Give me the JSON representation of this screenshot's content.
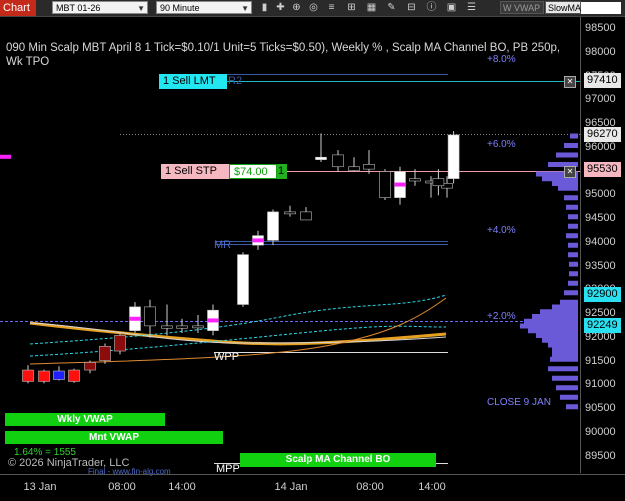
{
  "toolbar": {
    "chart_label": "Chart",
    "instrument": "MBT 01-26",
    "interval": "90 Minute",
    "buttons": {
      "vwap": "W VWAP",
      "slowma": "SlowMA"
    },
    "price_box": "",
    "icons": [
      "bars-icon",
      "crosshair-icon",
      "zoom-icon",
      "pan-icon",
      "properties-icon",
      "indicators-icon",
      "strategies-icon",
      "drawing-icon",
      "grid-icon",
      "info-icon",
      "save-icon",
      "menu-icon"
    ]
  },
  "title": "090 Min Scalp MBT April 8 1 Tick=$0.10/1 Unit=5 Ticks=$0.50), Weekly % , Scalp MA Channel BO, PB 250p, Wk TPO",
  "price_axis": {
    "ticks": [
      "98500",
      "98000",
      "97500",
      "97000",
      "96500",
      "96000",
      "95500",
      "95000",
      "94500",
      "94000",
      "93500",
      "93000",
      "92500",
      "92000",
      "91500",
      "91000",
      "90500",
      "90000",
      "89500"
    ],
    "badges": [
      {
        "value": "97410",
        "bg": "#e8e8e8"
      },
      {
        "value": "96270",
        "bg": "#e8e8e8"
      },
      {
        "value": "95530",
        "bg": "#f6b8c0"
      },
      {
        "value": "92900",
        "bg": "#28e0f0"
      },
      {
        "value": "92249",
        "bg": "#28e0f0"
      }
    ]
  },
  "time_axis": {
    "ticks": [
      "13 Jan",
      "08:00",
      "14:00",
      "14 Jan",
      "08:00",
      "14:00"
    ]
  },
  "orders": {
    "limit": {
      "label": "1 Sell LMT",
      "tag": "R2",
      "color": "#22e6f0"
    },
    "stop": {
      "label": "1 Sell STP",
      "pnl": "$74.00",
      "qty": "1",
      "color": "#f6b8c0"
    }
  },
  "labels": {
    "pct_8": "+8.0%",
    "pct_6": "+6.0%",
    "pct_4": "+4.0%",
    "pct_2": "+2.0%",
    "wpp": "WPP",
    "mr": "MR",
    "mpp": "MPP",
    "close": "CLOSE 9 JAN",
    "wkly_vwap": "Wkly VWAP",
    "mnt_vwap": "Mnt VWAP",
    "pct_note": "1.64% = 1555",
    "copyright": "© 2026 NinjaTrader, LLC",
    "website": "Final - www.fin-alg.com",
    "scalp_box": "Scalp MA Channel BO"
  },
  "chart_data": {
    "type": "candlestick",
    "title": "090 Min Scalp MBT April 8 1 Tick=$0.10/1 Unit=5 Ticks=$0.50), Weekly % , Scalp MA Channel BO, PB 250p, Wk TPO",
    "ylim": [
      89500,
      98500
    ],
    "candles": [
      {
        "t": "13 Jan",
        "o": 91320,
        "h": 91420,
        "l": 91040,
        "c": 91080,
        "color": "red"
      },
      {
        "t": "13 Jan",
        "o": 91080,
        "h": 91330,
        "l": 91040,
        "c": 91300,
        "color": "red"
      },
      {
        "t": "13 Jan",
        "o": 91300,
        "h": 91400,
        "l": 91100,
        "c": 91120,
        "color": "blue"
      },
      {
        "t": "13 Jan",
        "o": 91080,
        "h": 91350,
        "l": 91050,
        "c": 91320,
        "color": "red"
      },
      {
        "t": "13 Jan",
        "o": 91320,
        "h": 91520,
        "l": 91250,
        "c": 91480,
        "color": "darkred"
      },
      {
        "t": "13 Jan",
        "o": 91520,
        "h": 91880,
        "l": 91450,
        "c": 91820,
        "color": "darkred"
      },
      {
        "t": "08:00",
        "o": 91720,
        "h": 92120,
        "l": 91650,
        "c": 92050,
        "color": "darkred"
      },
      {
        "t": "08:00",
        "o": 92150,
        "h": 92750,
        "l": 92100,
        "c": 92650,
        "color": "white"
      },
      {
        "t": "08:00",
        "o": 92650,
        "h": 92800,
        "l": 92000,
        "c": 92250,
        "color": "black"
      },
      {
        "t": "08:00",
        "o": 92250,
        "h": 92700,
        "l": 92050,
        "c": 92200,
        "color": "black"
      },
      {
        "t": "14:00",
        "o": 92200,
        "h": 92400,
        "l": 92100,
        "c": 92250,
        "color": "black"
      },
      {
        "t": "14:00",
        "o": 92250,
        "h": 92480,
        "l": 92100,
        "c": 92220,
        "color": "black"
      },
      {
        "t": "14:00",
        "o": 92150,
        "h": 92700,
        "l": 92050,
        "c": 92580,
        "color": "white"
      },
      {
        "t": "14:00",
        "o": 92700,
        "h": 93800,
        "l": 92650,
        "c": 93750,
        "color": "white"
      },
      {
        "t": "14:00",
        "o": 93950,
        "h": 94250,
        "l": 93850,
        "c": 94150,
        "color": "white"
      },
      {
        "t": "14:00",
        "o": 94050,
        "h": 94700,
        "l": 93950,
        "c": 94650,
        "color": "white"
      },
      {
        "t": "14:00",
        "o": 94650,
        "h": 94780,
        "l": 94550,
        "c": 94650,
        "color": "black"
      },
      {
        "t": "14:00",
        "o": 94650,
        "h": 94750,
        "l": 94500,
        "c": 94480,
        "color": "black"
      },
      {
        "t": "14 Jan",
        "o": 95750,
        "h": 96300,
        "l": 95700,
        "c": 95800,
        "color": "white"
      },
      {
        "t": "14 Jan",
        "o": 95850,
        "h": 95950,
        "l": 95500,
        "c": 95600,
        "color": "black"
      },
      {
        "t": "14 Jan",
        "o": 95600,
        "h": 95800,
        "l": 95500,
        "c": 95520,
        "color": "black"
      },
      {
        "t": "14 Jan",
        "o": 95550,
        "h": 95950,
        "l": 95450,
        "c": 95650,
        "color": "black"
      },
      {
        "t": "08:00",
        "o": 95500,
        "h": 95550,
        "l": 94900,
        "c": 94950,
        "color": "black"
      },
      {
        "t": "08:00",
        "o": 94950,
        "h": 95600,
        "l": 94800,
        "c": 95500,
        "color": "white"
      },
      {
        "t": "08:00",
        "o": 95300,
        "h": 95550,
        "l": 95200,
        "c": 95350,
        "color": "black"
      },
      {
        "t": "08:00",
        "o": 95300,
        "h": 95400,
        "l": 94950,
        "c": 95280,
        "color": "black"
      },
      {
        "t": "14:00",
        "o": 95250,
        "h": 95400,
        "l": 94950,
        "c": 95150,
        "color": "black"
      },
      {
        "t": "14:00",
        "o": 95200,
        "h": 95550,
        "l": 95000,
        "c": 95350,
        "color": "black"
      },
      {
        "t": "14:00",
        "o": 95350,
        "h": 96350,
        "l": 95250,
        "c": 96270,
        "color": "white"
      }
    ]
  }
}
